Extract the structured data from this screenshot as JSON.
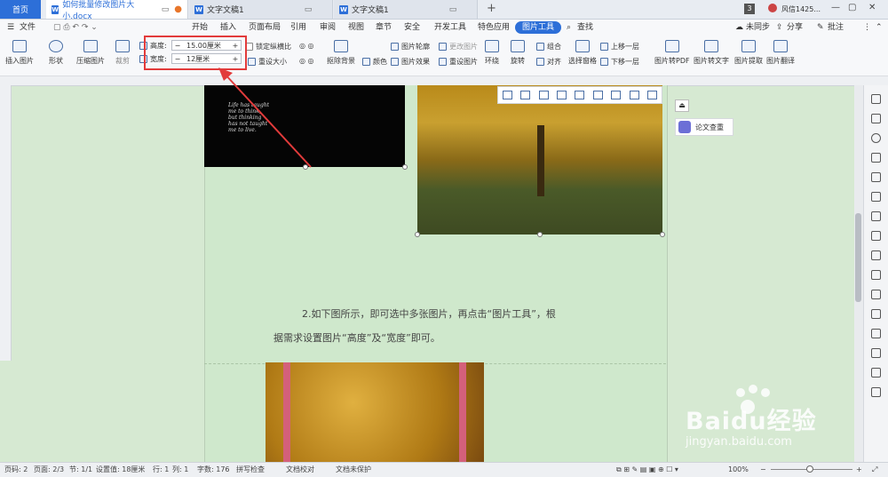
{
  "titlebar": {
    "home_tab": "首页",
    "doc_tab": "如何批量修改图片大小.docx",
    "tab2": "文字文稿1",
    "tab3": "文字文稿1",
    "new_tab": "+",
    "badge_count": "3",
    "user": "风信1425..."
  },
  "menubar": {
    "file": "文件",
    "items": [
      "开始",
      "插入",
      "页面布局",
      "引用",
      "审阅",
      "视图",
      "章节",
      "安全",
      "开发工具",
      "特色应用",
      "图片工具"
    ],
    "search": "查找",
    "sync": "未同步",
    "share": "分享",
    "comment": "批注"
  },
  "ribbon": {
    "insert_picture": "插入图片",
    "shape": "形状",
    "compress": "压缩图片",
    "crop": "裁剪",
    "height_label": "高度:",
    "height_value": "15.00厘米",
    "width_label": "宽度:",
    "width_value": "12厘米",
    "lock_ratio": "锁定纵横比",
    "reset_size": "重设大小",
    "remove_bg": "抠除背景",
    "color": "颜色",
    "pic_outline": "图片轮廓",
    "pic_effect": "图片效果",
    "change_pic": "更改图片",
    "reset_pic": "重设图片",
    "wrap": "环绕",
    "rotate": "旋转",
    "group": "组合",
    "align": "对齐",
    "select_pane": "选择窗格",
    "bring_forward": "上移一层",
    "send_backward": "下移一层",
    "to_pdf": "图片转PDF",
    "to_text": "图片转文字",
    "extract": "图片提取",
    "translate": "图片翻译"
  },
  "document": {
    "poem": "Life has taught\nme to think,\nbut thinking\nhas not taught\nme to live.",
    "line1": "2.如下图所示，即可选中多张图片，再点击“图片工具”，根",
    "line2": "据需求设置图片“高度”及“宽度”即可。"
  },
  "side_panel": {
    "lunwen": "论文查重"
  },
  "statusbar": {
    "page_num": "页码: 2",
    "page": "页面: 2/3",
    "section": "节: 1/1",
    "setting": "设置值: 18厘米",
    "row": "行: 1",
    "col": "列: 1",
    "words": "字数: 176",
    "spell": "拼写检查",
    "proof": "文档校对",
    "protect": "文档未保护",
    "zoom": "100%"
  },
  "watermark": {
    "brand": "Baidu经验",
    "url": "jingyan.baidu.com"
  },
  "colors": {
    "accent": "#2d6fd8",
    "annotation": "#e23b3b",
    "page_bg": "#cfe8cc"
  }
}
